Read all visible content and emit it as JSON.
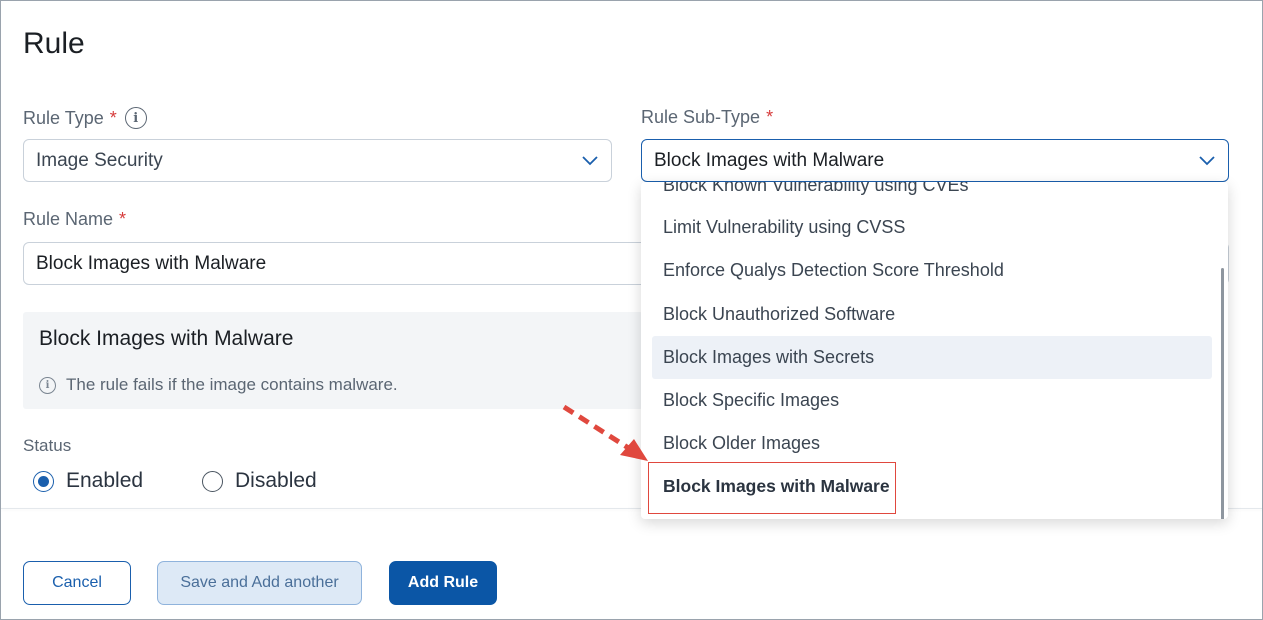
{
  "page": {
    "title": "Rule"
  },
  "rule_type": {
    "label": "Rule Type",
    "required_mark": "*",
    "info_icon": "info-circle-icon",
    "value": "Image Security"
  },
  "rule_subtype": {
    "label": "Rule Sub-Type",
    "required_mark": "*",
    "value": "Block Images with Malware"
  },
  "rule_name": {
    "label": "Rule Name",
    "required_mark": "*",
    "value": "Block Images with Malware"
  },
  "description": {
    "title": "Block Images with Malware",
    "text": "The rule fails if the image contains malware.",
    "icon": "info-circle-icon"
  },
  "status": {
    "label": "Status",
    "options": [
      {
        "label": "Enabled",
        "selected": true
      },
      {
        "label": "Disabled",
        "selected": false
      }
    ]
  },
  "dropdown": {
    "items": [
      {
        "label": "Block Known Vulnerability using CVEs"
      },
      {
        "label": "Limit Vulnerability using CVSS"
      },
      {
        "label": "Enforce Qualys Detection Score Threshold"
      },
      {
        "label": "Block Unauthorized Software"
      },
      {
        "label": "Block Images with Secrets"
      },
      {
        "label": "Block Specific Images"
      },
      {
        "label": "Block Older Images"
      },
      {
        "label": "Block Images with Malware"
      }
    ]
  },
  "buttons": {
    "cancel": "Cancel",
    "save_add_another": "Save and Add another",
    "add_rule": "Add Rule"
  },
  "colors": {
    "primary": "#0b56a6",
    "required": "#d63b3b",
    "annotation": "#e0483e"
  }
}
